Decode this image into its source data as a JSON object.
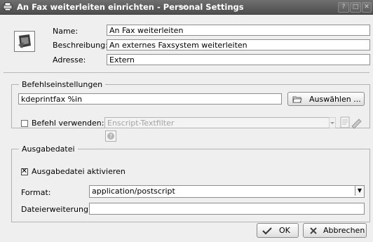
{
  "window": {
    "title": "An Fax weiterleiten einrichten - Personal Settings",
    "help_btn": "?",
    "restore_btn": "□",
    "close_btn": "✕"
  },
  "general": {
    "name_label": "Name:",
    "name_value": "An Fax weiterleiten",
    "description_label": "Beschreibung:",
    "description_value": "An externes Faxsystem weiterleiten",
    "address_label": "Adresse:",
    "address_value": "Extern"
  },
  "command": {
    "group_title": "Befehlseinstellungen",
    "command_value": "kdeprintfax %in",
    "select_button": "Auswählen ...",
    "use_filter_label": "Befehl verwenden:",
    "use_filter_checked": false,
    "filter_value": "Enscript-Textfilter"
  },
  "output": {
    "group_title": "Ausgabedatei",
    "enable_label": "Ausgabedatei aktivieren",
    "enable_checked": true,
    "format_label": "Format:",
    "format_value": "application/postscript",
    "extension_label": "Dateierweiterung:",
    "extension_value": ""
  },
  "footer": {
    "ok_button": "OK",
    "cancel_button": "Abbrechen"
  },
  "colors": {
    "titlebar": "#5e5e5e",
    "dialog_bg": "#efefef",
    "field_bg": "#ffffff"
  }
}
